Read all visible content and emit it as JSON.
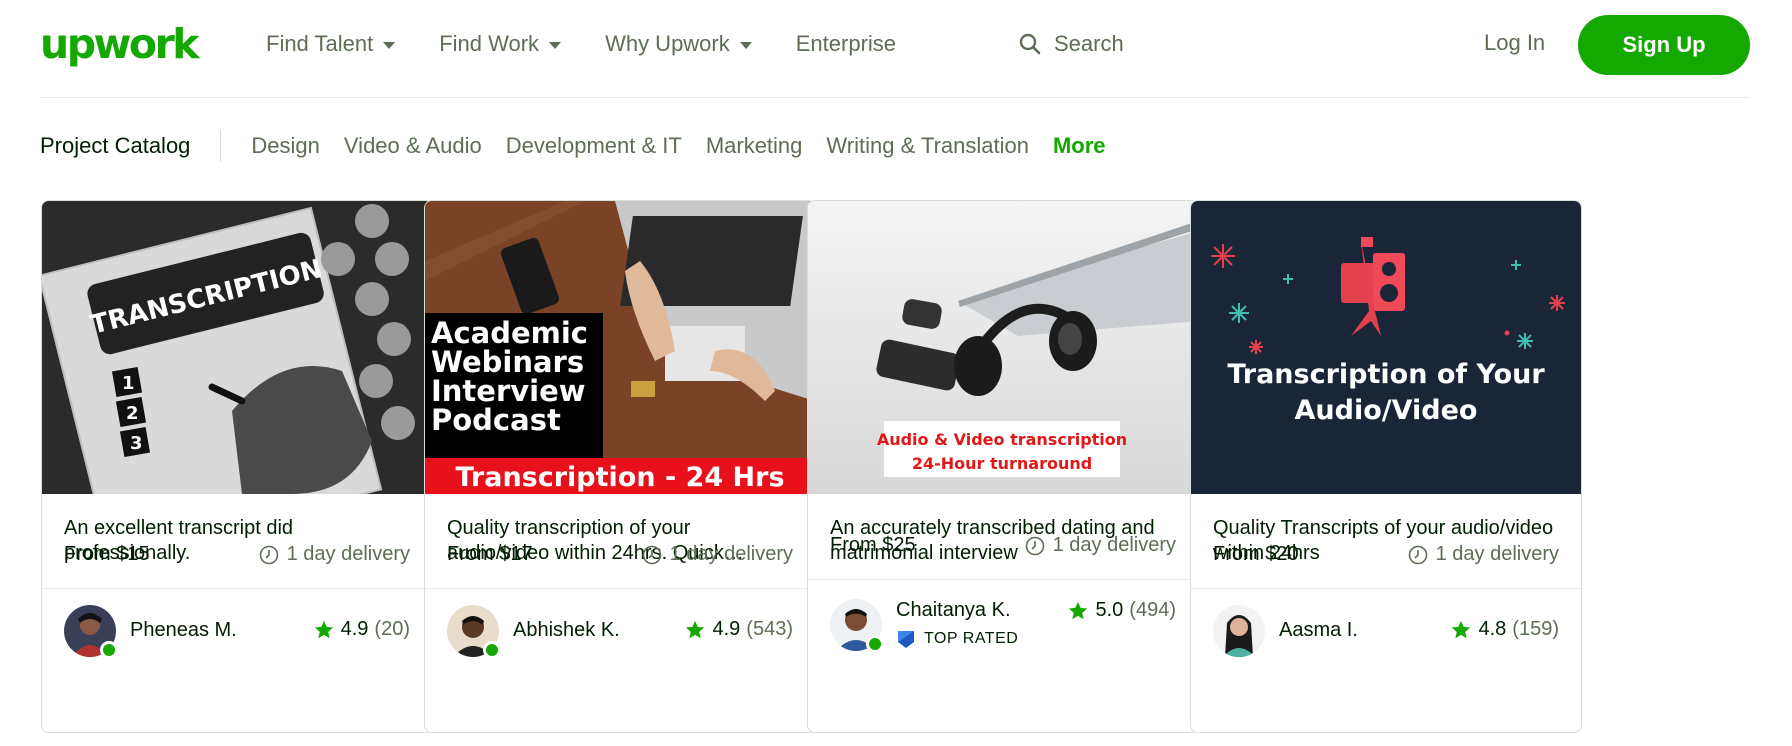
{
  "brand": {
    "logo_text": "upwork",
    "green": "#14a800"
  },
  "nav": {
    "items": [
      {
        "label": "Find Talent",
        "dropdown": true
      },
      {
        "label": "Find Work",
        "dropdown": true
      },
      {
        "label": "Why Upwork",
        "dropdown": true
      },
      {
        "label": "Enterprise",
        "dropdown": false
      }
    ],
    "search_label": "Search",
    "login_label": "Log In",
    "signup_label": "Sign Up"
  },
  "category_bar": {
    "catalog_label": "Project Catalog",
    "categories": [
      "Design",
      "Video & Audio",
      "Development & IT",
      "Marketing",
      "Writing & Translation"
    ],
    "more_label": "More"
  },
  "cards": [
    {
      "image": {
        "banner_text": "TRANSCRIPTION",
        "numbers": [
          "1",
          "2",
          "3"
        ]
      },
      "title": "An excellent transcript did professionally.",
      "price_prefix": "From ",
      "price": "$15",
      "delivery": "1 day delivery",
      "seller": "Pheneas M.",
      "online": true,
      "rating": "4.9",
      "reviews": "(20)",
      "top_rated": false
    },
    {
      "image": {
        "lines": [
          "Academic",
          "Webinars",
          "Interview",
          "Podcast"
        ],
        "banner_text": "Transcription - 24 Hrs"
      },
      "title": "Quality transcription of your audio/video within 24hrs. Quick…",
      "price_prefix": "From ",
      "price": "$17",
      "delivery": "1 day delivery",
      "seller": "Abhishek K.",
      "online": true,
      "rating": "4.9",
      "reviews": "(543)",
      "top_rated": false
    },
    {
      "image": {
        "line1": "Audio & Video transcription",
        "line2": "24-Hour turnaround"
      },
      "title": "An accurately transcribed dating and matrimonial interview",
      "price_prefix": "From ",
      "price": "$25",
      "delivery": "1 day delivery",
      "seller": "Chaitanya K.",
      "online": true,
      "rating": "5.0",
      "reviews": "(494)",
      "top_rated": true,
      "badge_label": "TOP RATED"
    },
    {
      "image": {
        "line1": "Transcription of Your",
        "line2": "Audio/Video"
      },
      "title": "Quality Transcripts of your audio/video within 24hrs",
      "price_prefix": "From ",
      "price": "$20",
      "delivery": "1 day delivery",
      "seller": "Aasma I.",
      "online": false,
      "rating": "4.8",
      "reviews": "(159)",
      "top_rated": false
    }
  ]
}
